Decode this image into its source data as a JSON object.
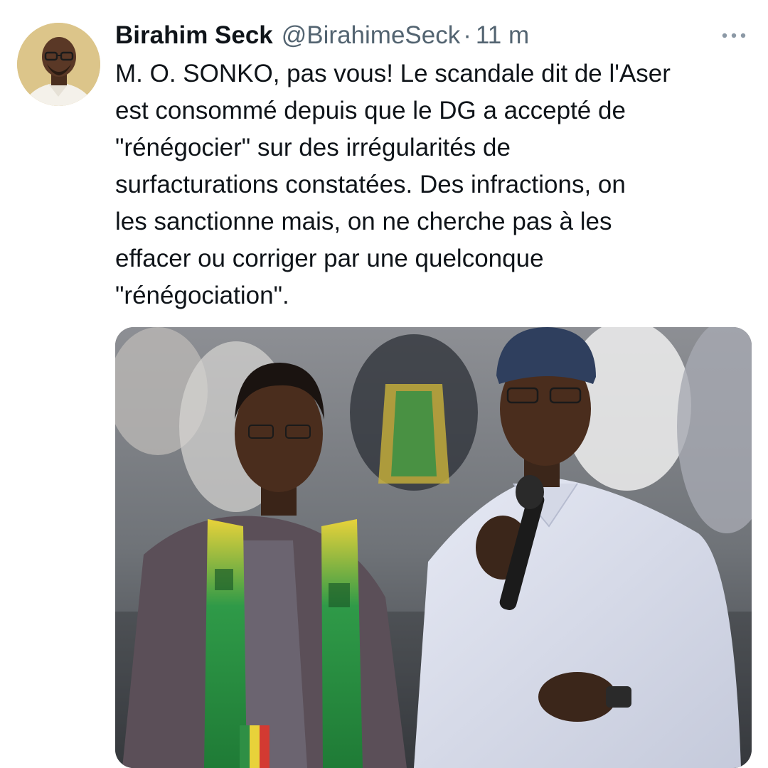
{
  "tweet": {
    "author_name": "Birahim Seck",
    "author_handle": "@BirahimeSeck",
    "separator": "·",
    "timestamp": "11 m",
    "text_lines": [
      "M. O. SONKO, pas vous! Le scandale dit de l'Aser",
      "est consommé depuis que le DG a accepté de",
      "\"rénégocier\" sur des irrégularités de",
      "surfacturations constatées. Des infractions, on",
      "les sanctionne mais, on ne cherche pas à les",
      "effacer ou corriger par une quelconque",
      "\"rénégociation\"."
    ],
    "more_icon": "more-horizontal-icon",
    "avatar": "author-avatar-photo",
    "media": "photo-two-men-at-rally-with-microphone"
  },
  "colors": {
    "text_primary": "#0f1419",
    "text_secondary": "#536471",
    "background": "#ffffff"
  }
}
